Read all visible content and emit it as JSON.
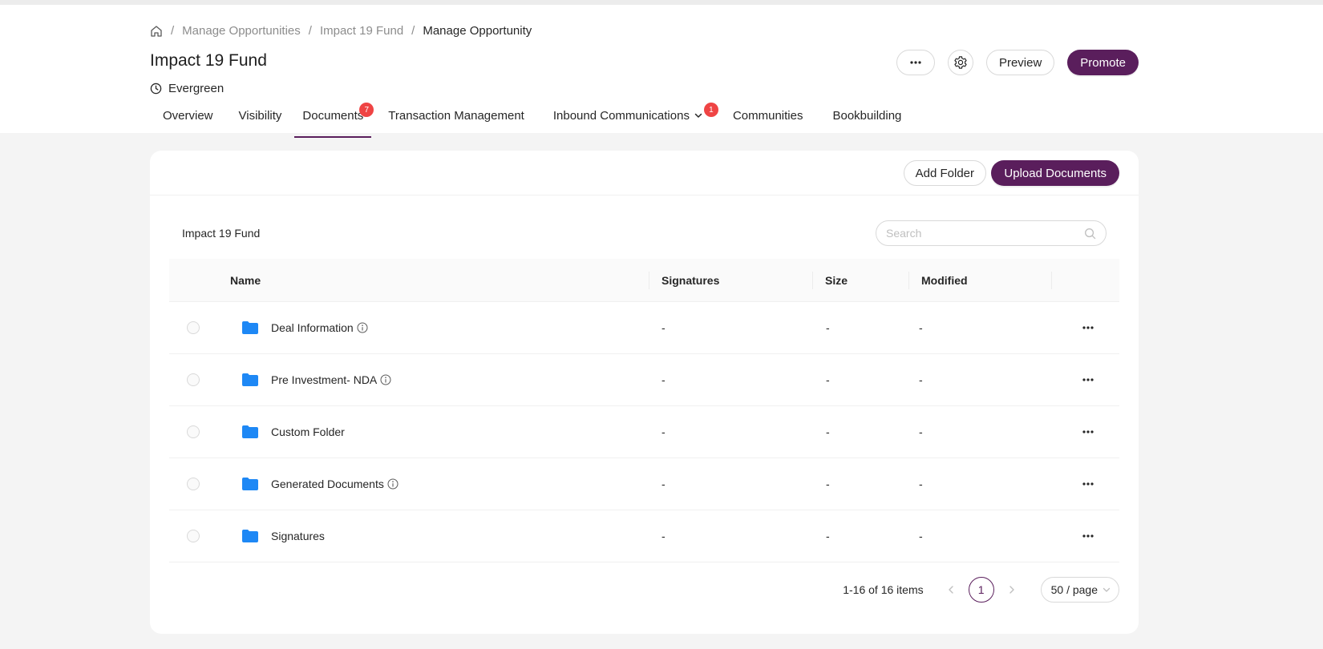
{
  "breadcrumb": {
    "items": [
      "Manage Opportunities",
      "Impact 19 Fund"
    ],
    "current": "Manage Opportunity",
    "separator": "/"
  },
  "page": {
    "title": "Impact 19 Fund",
    "subtitle": "Evergreen"
  },
  "actions": {
    "preview_label": "Preview",
    "promote_label": "Promote"
  },
  "tabs": [
    {
      "label": "Overview"
    },
    {
      "label": "Visibility"
    },
    {
      "label": "Documents",
      "badge": "7"
    },
    {
      "label": "Transaction Management"
    },
    {
      "label": "Inbound Communications",
      "badge": "1"
    },
    {
      "label": "Communities"
    },
    {
      "label": "Bookbuilding"
    }
  ],
  "toolbar": {
    "add_folder_label": "Add Folder",
    "upload_label": "Upload Documents"
  },
  "folder": {
    "title": "Impact 19 Fund",
    "search_placeholder": "Search"
  },
  "table": {
    "columns": [
      "Name",
      "Signatures",
      "Size",
      "Modified"
    ],
    "rows": [
      {
        "name": "Deal Information",
        "info": true,
        "signatures": "-",
        "size": "-",
        "modified": "-"
      },
      {
        "name": "Pre Investment- NDA",
        "info": true,
        "signatures": "-",
        "size": "-",
        "modified": "-"
      },
      {
        "name": "Custom Folder",
        "info": false,
        "signatures": "-",
        "size": "-",
        "modified": "-"
      },
      {
        "name": "Generated Documents",
        "info": true,
        "signatures": "-",
        "size": "-",
        "modified": "-"
      },
      {
        "name": "Signatures",
        "info": false,
        "signatures": "-",
        "size": "-",
        "modified": "-"
      }
    ]
  },
  "pagination": {
    "total_text": "1-16 of 16 items",
    "current_page": "1",
    "page_size": "50 / page"
  },
  "colors": {
    "primary": "#5a1e5c",
    "badge": "#ef4444",
    "folder": "#1e88f5"
  }
}
